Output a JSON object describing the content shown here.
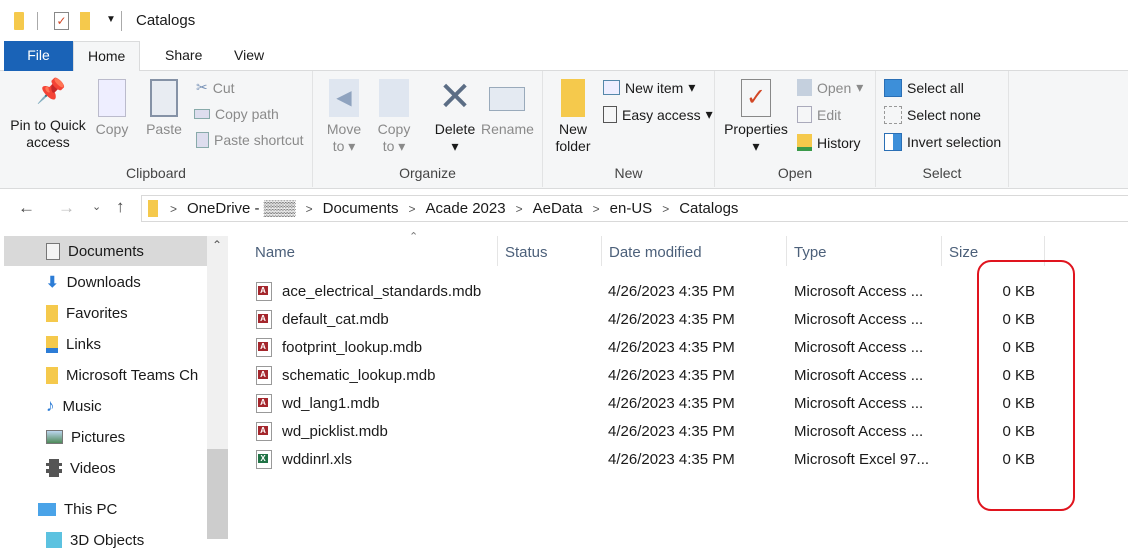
{
  "window": {
    "title": "Catalogs"
  },
  "tabs": [
    "File",
    "Home",
    "Share",
    "View"
  ],
  "ribbon": {
    "clipboard": {
      "label": "Clipboard",
      "pin": "Pin to Quick access",
      "copy": "Copy",
      "paste": "Paste",
      "cut": "Cut",
      "copy_path": "Copy path",
      "paste_shortcut": "Paste shortcut"
    },
    "organize": {
      "label": "Organize",
      "move_to": "Move to",
      "copy_to": "Copy to",
      "delete": "Delete",
      "rename": "Rename"
    },
    "new": {
      "label": "New",
      "new_folder": "New folder",
      "new_item": "New item",
      "easy_access": "Easy access"
    },
    "open": {
      "label": "Open",
      "properties": "Properties",
      "open": "Open",
      "edit": "Edit",
      "history": "History"
    },
    "select": {
      "label": "Select",
      "select_all": "Select all",
      "select_none": "Select none",
      "invert": "Invert selection"
    }
  },
  "breadcrumb": [
    "OneDrive - ▒▒▒",
    "Documents",
    "Acade 2023",
    "AeData",
    "en-US",
    "Catalogs"
  ],
  "nav": [
    "Documents",
    "Downloads",
    "Favorites",
    "Links",
    "Microsoft Teams Ch",
    "Music",
    "Pictures",
    "Videos",
    "This PC",
    "3D Objects"
  ],
  "columns": {
    "name": "Name",
    "status": "Status",
    "date": "Date modified",
    "type": "Type",
    "size": "Size"
  },
  "files": [
    {
      "name": "ace_electrical_standards.mdb",
      "date": "4/26/2023 4:35 PM",
      "type": "Microsoft Access ...",
      "size": "0 KB",
      "kind": "access"
    },
    {
      "name": "default_cat.mdb",
      "date": "4/26/2023 4:35 PM",
      "type": "Microsoft Access ...",
      "size": "0 KB",
      "kind": "access"
    },
    {
      "name": "footprint_lookup.mdb",
      "date": "4/26/2023 4:35 PM",
      "type": "Microsoft Access ...",
      "size": "0 KB",
      "kind": "access"
    },
    {
      "name": "schematic_lookup.mdb",
      "date": "4/26/2023 4:35 PM",
      "type": "Microsoft Access ...",
      "size": "0 KB",
      "kind": "access"
    },
    {
      "name": "wd_lang1.mdb",
      "date": "4/26/2023 4:35 PM",
      "type": "Microsoft Access ...",
      "size": "0 KB",
      "kind": "access"
    },
    {
      "name": "wd_picklist.mdb",
      "date": "4/26/2023 4:35 PM",
      "type": "Microsoft Access ...",
      "size": "0 KB",
      "kind": "access"
    },
    {
      "name": "wddinrl.xls",
      "date": "4/26/2023 4:35 PM",
      "type": "Microsoft Excel 97...",
      "size": "0 KB",
      "kind": "excel"
    }
  ],
  "colors": {
    "file_tab": "#1a63b7",
    "highlight": "#e0141e",
    "access": "#a4262c",
    "excel": "#217346"
  }
}
